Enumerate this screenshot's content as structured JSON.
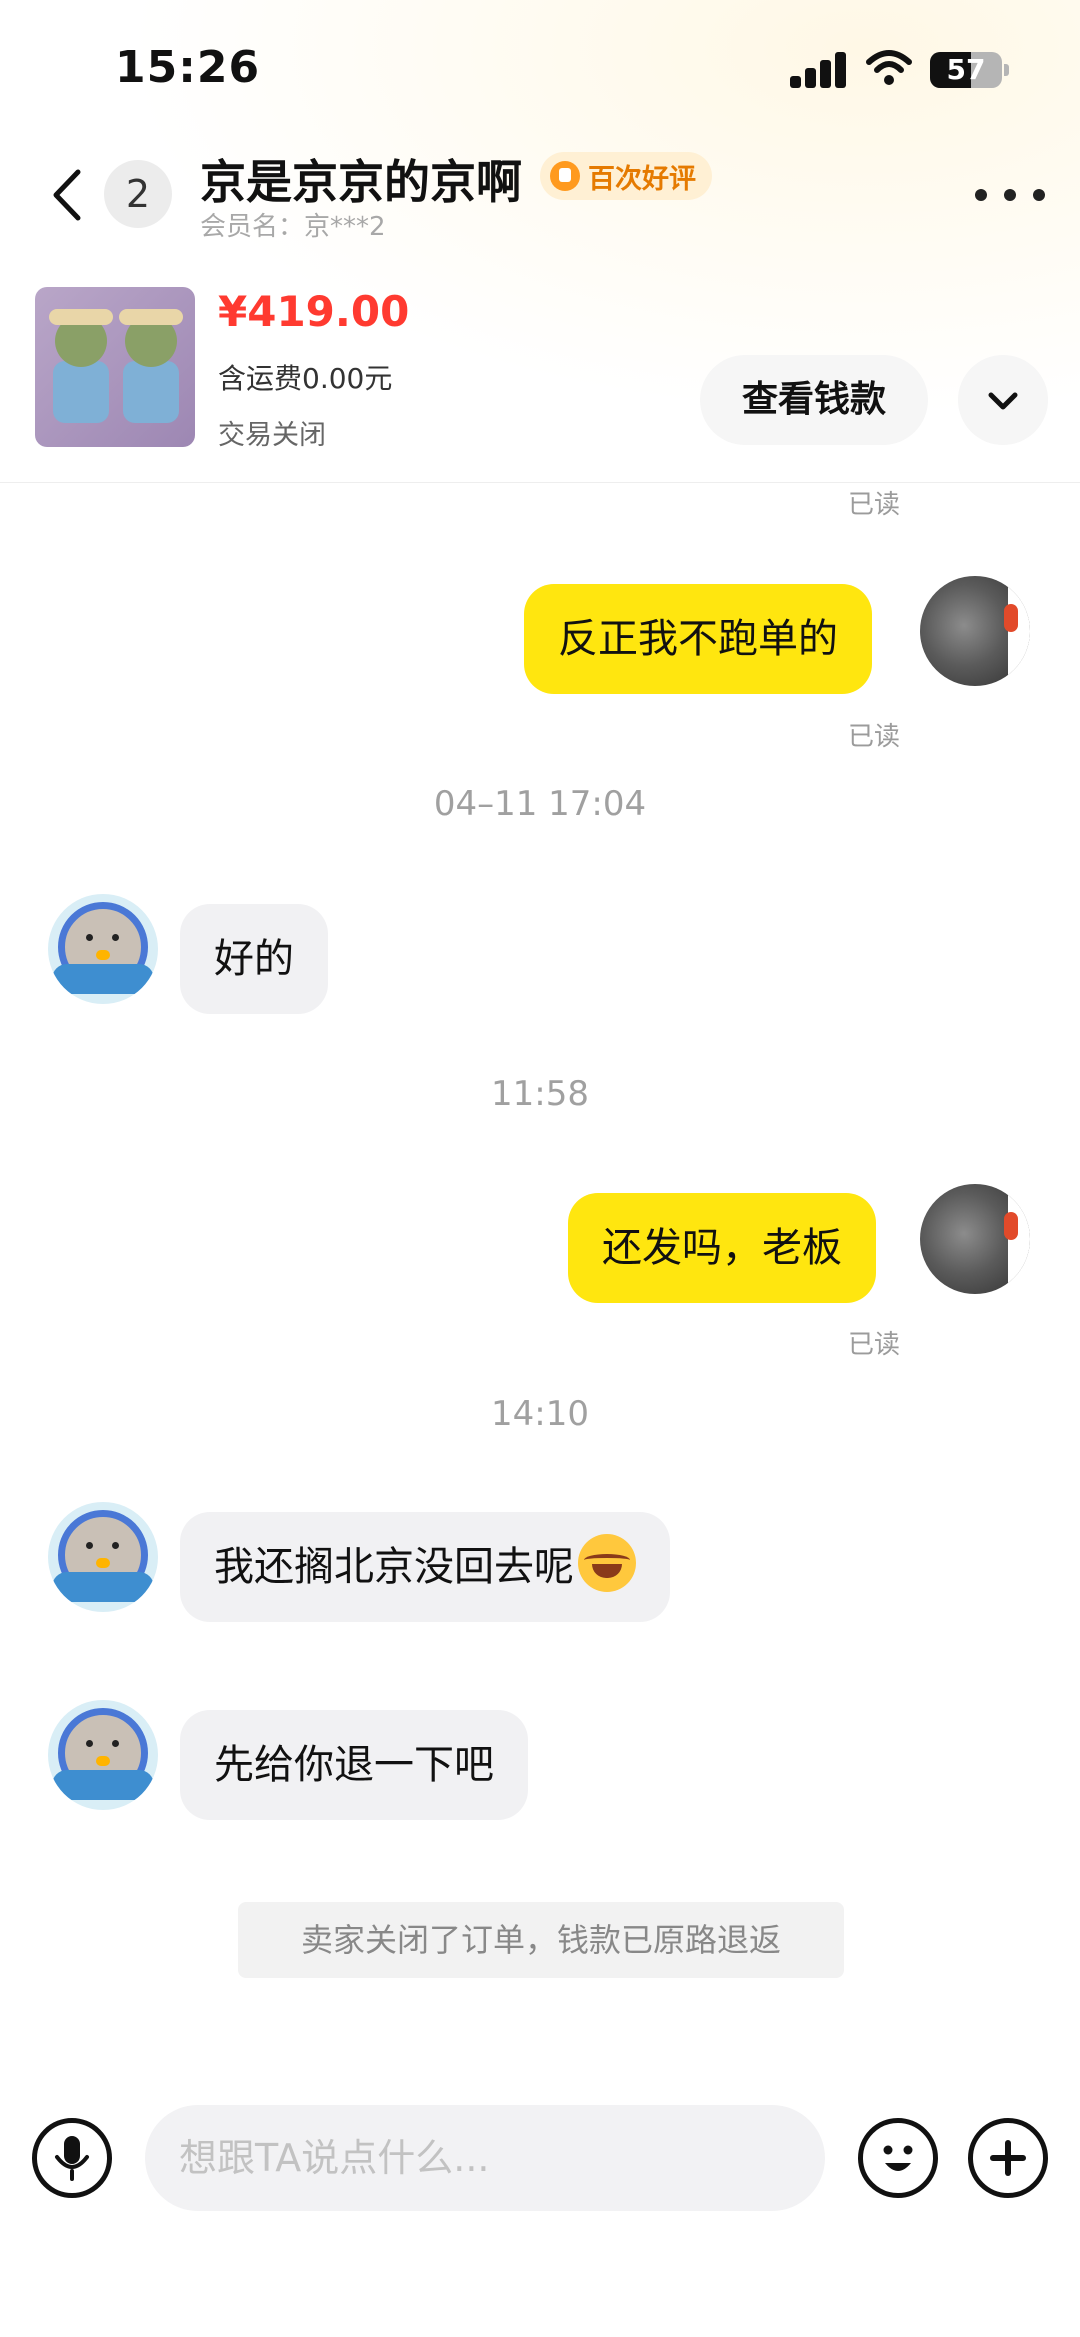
{
  "status_bar": {
    "time": "15:26",
    "battery_level": "57",
    "battery_fraction": 0.57
  },
  "header": {
    "unread_count": "2",
    "title": "京是京京的京啊",
    "badge": "百次好评",
    "member_label": "会员名：京***2"
  },
  "product": {
    "price": "¥419.00",
    "shipping": "含运费0.00元",
    "status": "交易关闭",
    "view_money_label": "查看钱款"
  },
  "messages": [
    {
      "read_top": "已读"
    },
    {
      "from": "me",
      "text": "反正我不跑单的",
      "read": "已读"
    },
    {
      "timestamp": "04–11 17:04"
    },
    {
      "from": "them",
      "text": "好的"
    },
    {
      "timestamp": "11:58"
    },
    {
      "from": "me",
      "text": "还发吗，老板",
      "read": "已读"
    },
    {
      "timestamp": "14:10"
    },
    {
      "from": "them",
      "text": "我还搁北京没回去呢"
    },
    {
      "from": "them",
      "text": "先给你退一下吧"
    },
    {
      "system": "卖家关闭了订单，钱款已原路退返"
    }
  ],
  "input": {
    "placeholder": "想跟TA说点什么..."
  },
  "colors": {
    "my_bubble": "#ffe60f",
    "their_bubble": "#f1f1f3",
    "price": "#ff3a30",
    "badge_text": "#e57a00"
  }
}
